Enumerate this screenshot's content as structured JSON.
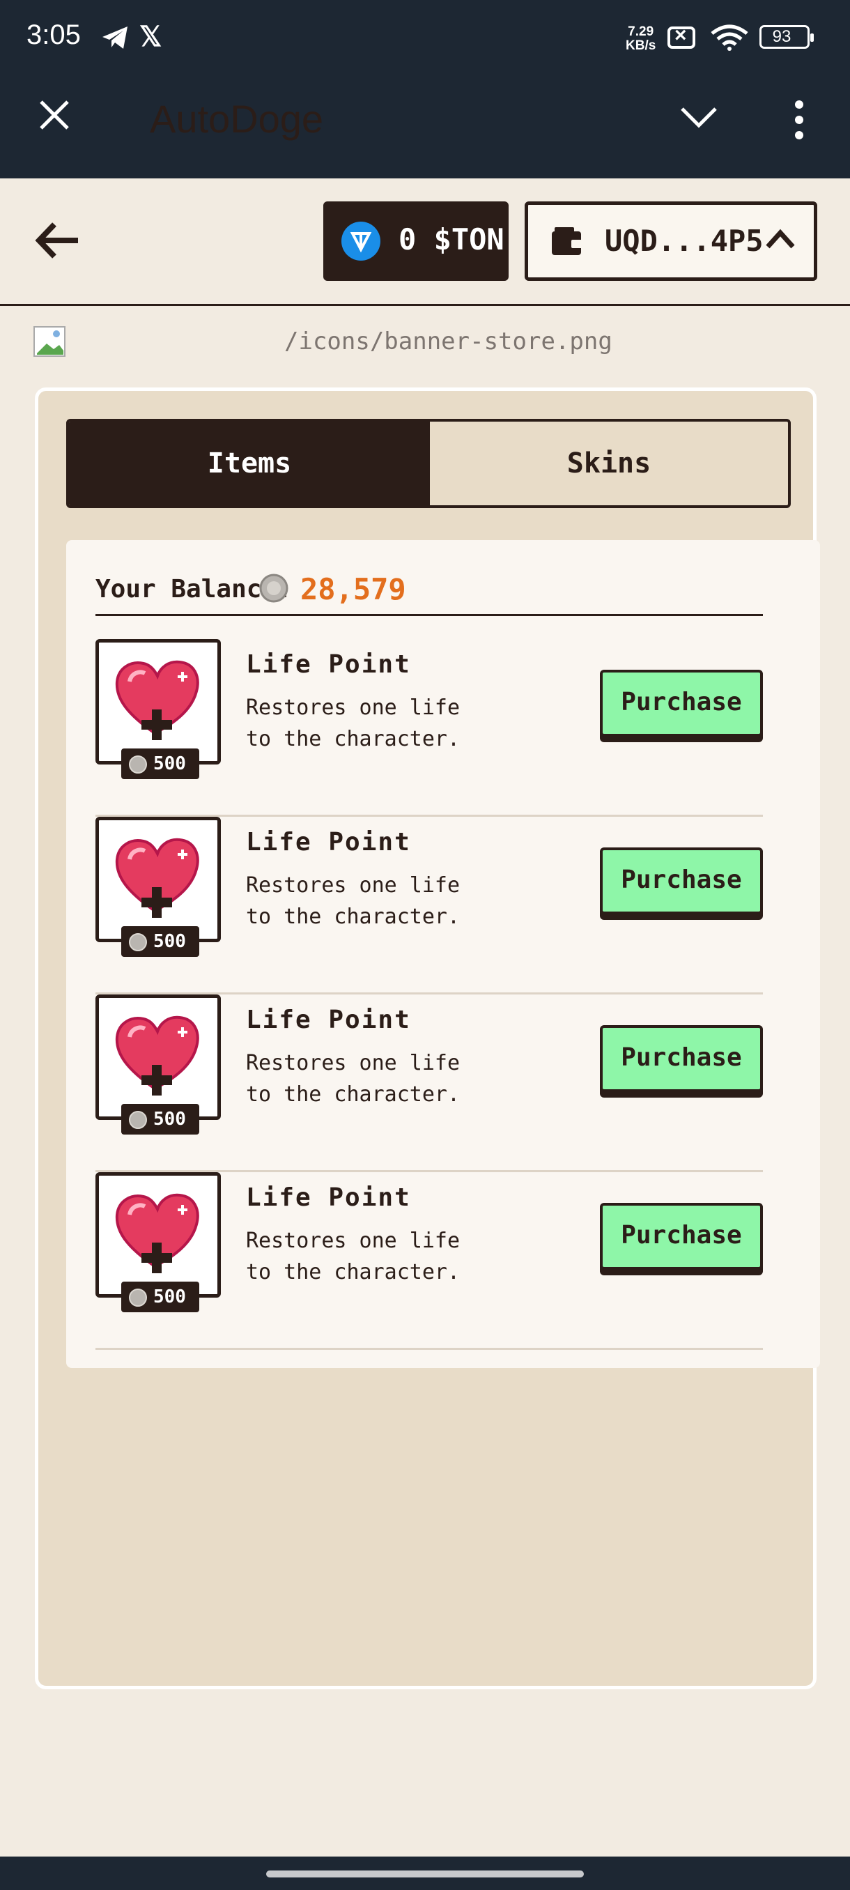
{
  "status_bar": {
    "time": "3:05",
    "net_speed_value": "7.29",
    "net_speed_unit": "KB/s",
    "battery": "93"
  },
  "app_bar": {
    "title": "AutoDoge"
  },
  "header": {
    "ton_balance": "0 $TON",
    "wallet_address": "UQD...4P5"
  },
  "banner": {
    "alt": "/icons/banner-store.png"
  },
  "tabs": [
    {
      "label": "Items",
      "active": true
    },
    {
      "label": "Skins",
      "active": false
    }
  ],
  "balance": {
    "label": "Your Balance:",
    "value": "28,579"
  },
  "items": [
    {
      "name": "Life Point",
      "description": "Restores one life to the character.",
      "price": "500",
      "button": "Purchase"
    },
    {
      "name": "Life Point",
      "description": "Restores one life to the character.",
      "price": "500",
      "button": "Purchase"
    },
    {
      "name": "Life Point",
      "description": "Restores one life to the character.",
      "price": "500",
      "button": "Purchase"
    },
    {
      "name": "Life Point",
      "description": "Restores one life to the character.",
      "price": "500",
      "button": "Purchase"
    }
  ],
  "colors": {
    "dark": "#2b1d18",
    "accent_orange": "#e36e1d",
    "button_green": "#8ef6a8",
    "ton_blue": "#1a8ee8",
    "appbar": "#1d2733"
  }
}
